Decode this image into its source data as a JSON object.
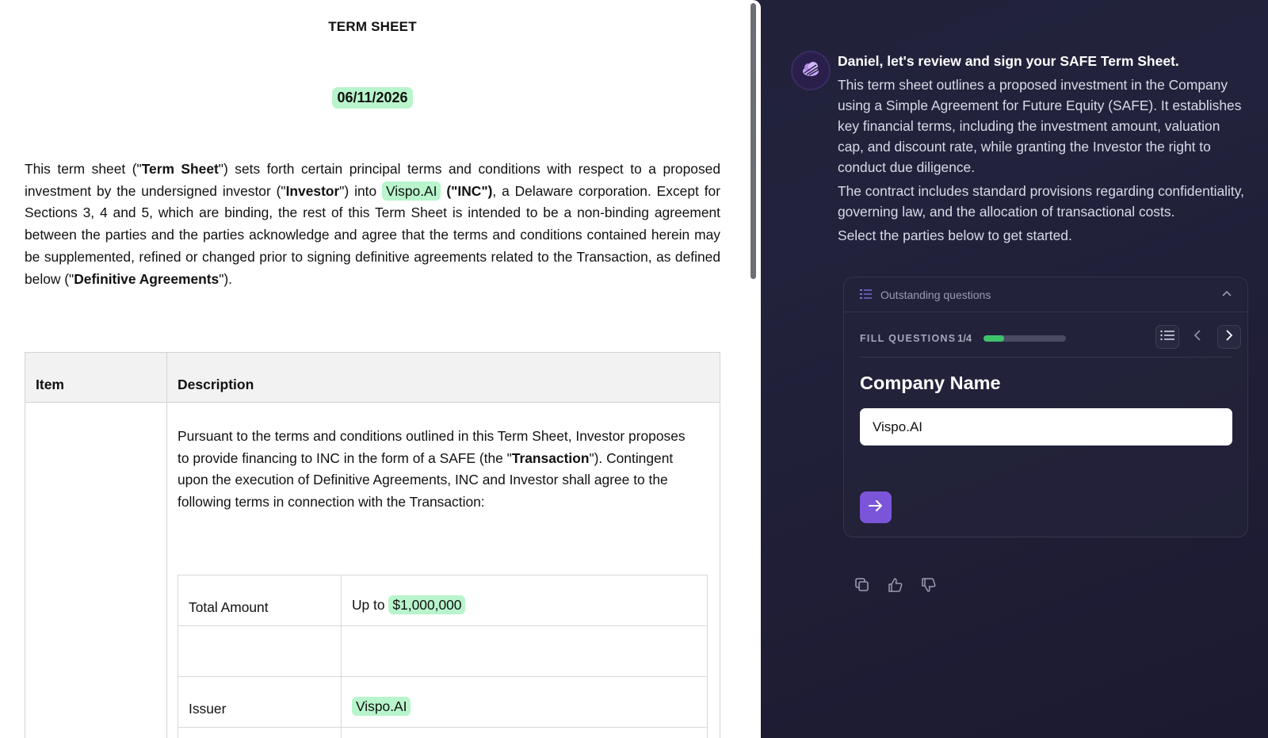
{
  "document": {
    "title": "TERM SHEET",
    "date": "06/11/2026",
    "intro": {
      "t1": "This term sheet (\"",
      "b1": "Term Sheet",
      "t2": "\") sets forth certain principal terms and conditions with respect to a proposed investment by the undersigned investor (\"",
      "b2": "Investor",
      "t3": "\") into ",
      "company": "Vispo.AI",
      "b3": "(\"INC\")",
      "t4": ", a Delaware corporation. Except for Sections 3, 4 and 5, which are binding, the rest of this Term Sheet is intended to be a non-binding agreement between the parties and the parties acknowledge and agree that the terms and conditions contained herein may be supplemented, refined or changed prior to signing definitive agreements related to the Transaction, as defined below (\"",
      "b4": "Definitive Agreements",
      "t5": "\")."
    },
    "table": {
      "col_item": "Item",
      "col_description": "Description",
      "desc": {
        "t1": "Pursuant to the terms and conditions outlined in this Term Sheet, Investor proposes to provide financing to INC in the form of a SAFE (the \"",
        "b1": "Transaction",
        "t2": "\"). Contingent upon the execution of Definitive Agreements, INC and Investor shall agree to the following terms in connection with the Transaction:"
      },
      "rows": [
        {
          "label": "Total Amount",
          "prefix": "Up to",
          "value": "$1,000,000"
        },
        {
          "label": "",
          "prefix": "",
          "value": ""
        },
        {
          "label": "Issuer",
          "prefix": "",
          "value": "Vispo.AI"
        }
      ]
    }
  },
  "chat": {
    "message": {
      "title": "Daniel, let's review and sign your SAFE Term Sheet.",
      "p1": "This term sheet outlines a proposed investment in the Company using a Simple Agreement for Future Equity (SAFE). It establishes key financial terms, including the investment amount, valuation cap, and discount rate, while granting the Investor the right to conduct due diligence.",
      "p2": "The contract includes standard provisions regarding confidentiality, governing law, and the allocation of transactional costs.",
      "p3": "Select the parties below to get started."
    },
    "questions": {
      "header": "Outstanding questions",
      "fill_label": "FILL QUESTIONS",
      "count": "1/4",
      "progress": 0.25,
      "question_title": "Company Name",
      "input_value": "Vispo.AI"
    }
  },
  "colors": {
    "highlight": "#b8f5cc",
    "accent": "#7b55d9",
    "progress": "#3ec26a",
    "chat_bg": "#1f2038"
  },
  "icons": [
    "cloud-logo-icon",
    "list-icon",
    "chevron-up-icon",
    "list-view-icon",
    "chevron-left-icon",
    "chevron-right-icon",
    "arrow-right-icon",
    "copy-icon",
    "thumbs-up-icon",
    "thumbs-down-icon"
  ]
}
